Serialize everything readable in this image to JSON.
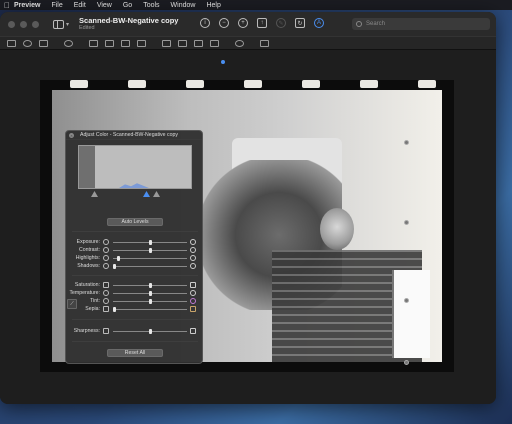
{
  "menubar": {
    "app_name": "Preview",
    "items": [
      "File",
      "Edit",
      "View",
      "Go",
      "Tools",
      "Window",
      "Help"
    ]
  },
  "window": {
    "title": "Scanned-BW-Negative copy",
    "subtitle": "Edited",
    "search_placeholder": "Search",
    "accent_color": "#4a8ef0"
  },
  "panel": {
    "title": "Adjust Color - Scanned-BW-Negative copy",
    "auto_levels": "Auto Levels",
    "reset_all": "Reset All",
    "sliders": [
      {
        "label": "Exposure:",
        "value": 0.5
      },
      {
        "label": "Contrast:",
        "value": 0.5
      },
      {
        "label": "Highlights:",
        "value": 0.05
      },
      {
        "label": "Shadows:",
        "value": 0.0
      },
      {
        "label": "Saturation:",
        "value": 0.5
      },
      {
        "label": "Temperature:",
        "value": 0.5
      },
      {
        "label": "Tint:",
        "value": 0.5
      },
      {
        "label": "Sepia:",
        "value": 0.0
      },
      {
        "label": "Sharpness:",
        "value": 0.5
      }
    ]
  }
}
